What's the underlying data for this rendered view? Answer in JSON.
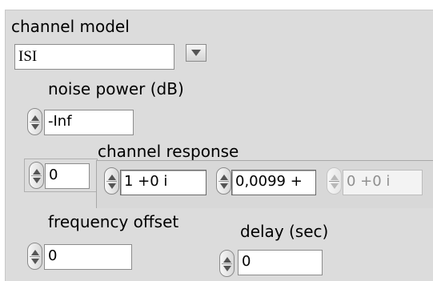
{
  "channel_model": {
    "label": "channel model",
    "selected": "ISI"
  },
  "noise_power": {
    "label": "noise power (dB)",
    "value": "-Inf"
  },
  "channel_response": {
    "label": "channel response",
    "index": "0",
    "elements": [
      "1 +0 i",
      "0,0099 +",
      "0 +0 i"
    ]
  },
  "frequency_offset": {
    "label": "frequency offset",
    "value": "0"
  },
  "delay": {
    "label": "delay (sec)",
    "value": "0"
  }
}
